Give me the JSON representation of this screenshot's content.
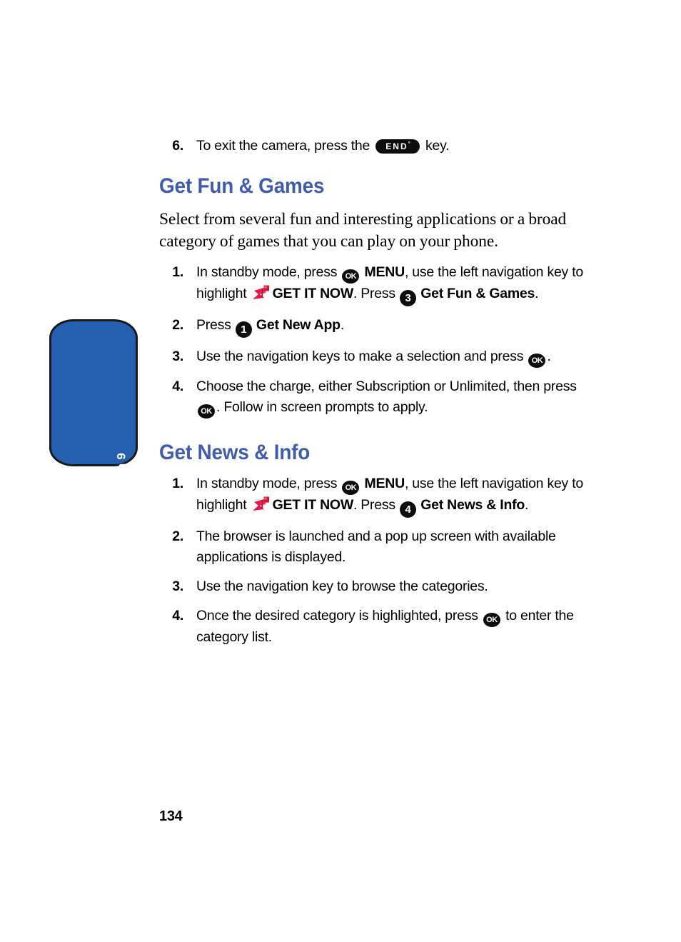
{
  "page": {
    "number": "134",
    "section_tab_label": "Section 9",
    "tab_color": "#2560b0",
    "heading_color": "#3f5cad"
  },
  "icons": {
    "ok": "OK",
    "end": "END",
    "end_sup": "°",
    "get_it_now": "get-it-now-icon"
  },
  "top_step": {
    "number": "6.",
    "text_before": "To exit the camera, press the",
    "text_after": "key."
  },
  "sections": [
    {
      "heading": "Get Fun & Games",
      "intro": "Select from several fun and interesting applications or a broad category of games that you can play on your phone.",
      "steps": [
        {
          "number": "1.",
          "parts": [
            {
              "t": "text",
              "v": "In standby mode, press "
            },
            {
              "t": "ok"
            },
            {
              "t": "bold",
              "v": " MENU"
            },
            {
              "t": "text",
              "v": ", use the left navigation key to highlight "
            },
            {
              "t": "getitnow"
            },
            {
              "t": "bold",
              "v": "GET IT NOW"
            },
            {
              "t": "text",
              "v": ". Press "
            },
            {
              "t": "circnum",
              "v": "3"
            },
            {
              "t": "bold",
              "v": " Get Fun & Games"
            },
            {
              "t": "text",
              "v": "."
            }
          ]
        },
        {
          "number": "2.",
          "parts": [
            {
              "t": "text",
              "v": "Press "
            },
            {
              "t": "circnum",
              "v": "1"
            },
            {
              "t": "bold",
              "v": " Get New App"
            },
            {
              "t": "text",
              "v": "."
            }
          ]
        },
        {
          "number": "3.",
          "parts": [
            {
              "t": "text",
              "v": "Use the navigation keys to make a selection and press "
            },
            {
              "t": "ok"
            },
            {
              "t": "text",
              "v": "."
            }
          ]
        },
        {
          "number": "4.",
          "parts": [
            {
              "t": "text",
              "v": "Choose the charge, either Subscription or Unlimited, then press "
            },
            {
              "t": "ok"
            },
            {
              "t": "text",
              "v": ". Follow in screen prompts to apply."
            }
          ]
        }
      ]
    },
    {
      "heading": "Get News & Info",
      "intro": "",
      "steps": [
        {
          "number": "1.",
          "parts": [
            {
              "t": "text",
              "v": "In standby mode, press "
            },
            {
              "t": "ok"
            },
            {
              "t": "bold",
              "v": " MENU"
            },
            {
              "t": "text",
              "v": ", use the left navigation key to highlight "
            },
            {
              "t": "getitnow"
            },
            {
              "t": "bold",
              "v": "GET IT NOW"
            },
            {
              "t": "text",
              "v": ". Press "
            },
            {
              "t": "circnum",
              "v": "4"
            },
            {
              "t": "bold",
              "v": " Get News & Info"
            },
            {
              "t": "text",
              "v": "."
            }
          ]
        },
        {
          "number": "2.",
          "parts": [
            {
              "t": "text",
              "v": "The browser is launched and a pop up screen with available applications is displayed."
            }
          ]
        },
        {
          "number": "3.",
          "parts": [
            {
              "t": "text",
              "v": "Use the navigation key to browse the categories."
            }
          ]
        },
        {
          "number": "4.",
          "parts": [
            {
              "t": "text",
              "v": "Once the desired category is highlighted, press "
            },
            {
              "t": "ok"
            },
            {
              "t": "text",
              "v": " to enter the category list."
            }
          ]
        }
      ]
    }
  ]
}
